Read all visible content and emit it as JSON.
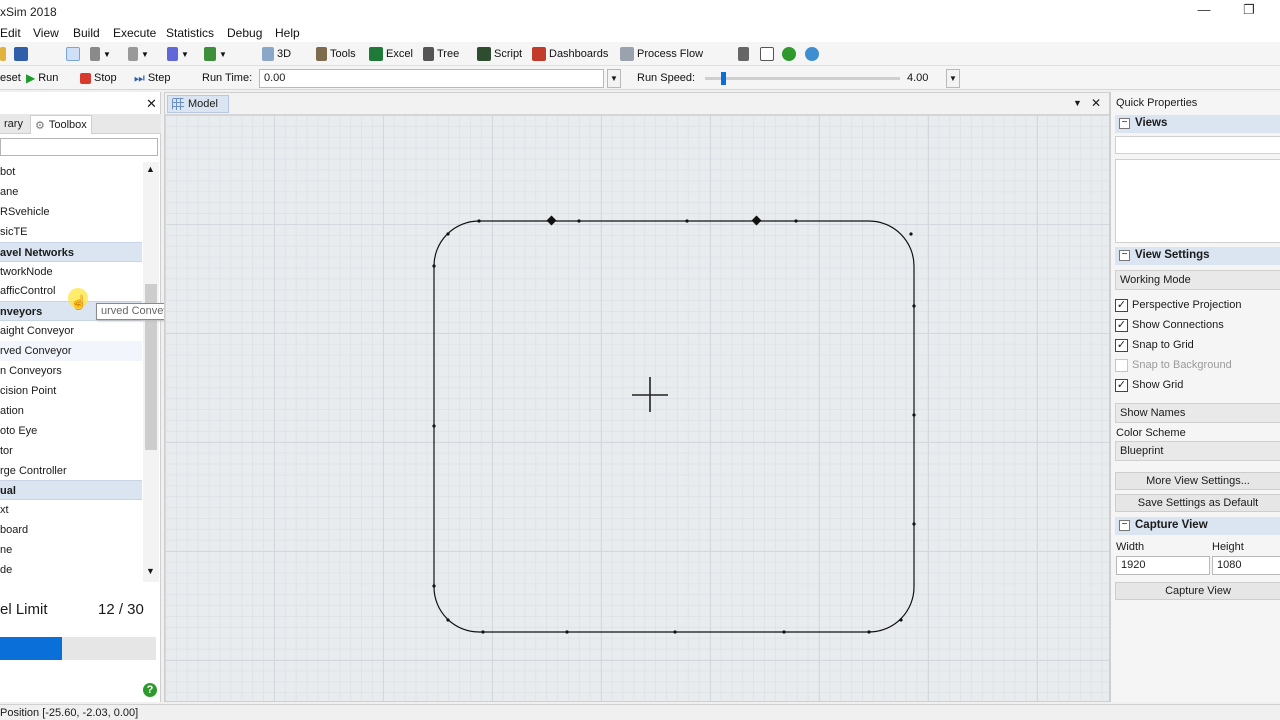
{
  "app": {
    "title": "xSim 2018",
    "minimize_glyph": "—",
    "restore_glyph": "❐"
  },
  "menu": [
    "Edit",
    "View",
    "Build",
    "Execute",
    "Statistics",
    "Debug",
    "Help"
  ],
  "toolbar": {
    "view3d": "3D",
    "tools": "Tools",
    "excel": "Excel",
    "tree": "Tree",
    "script": "Script",
    "dashboards": "Dashboards",
    "process_flow": "Process Flow"
  },
  "run_bar": {
    "reset": "eset",
    "run": "Run",
    "stop": "Stop",
    "step": "Step",
    "run_time_label": "Run Time:",
    "run_time_value": "0.00",
    "run_speed_label": "Run Speed:",
    "run_speed_value": "4.00",
    "run_speed_fraction": 0.08
  },
  "left_panel": {
    "tabs": {
      "library": "rary",
      "toolbox": "Toolbox"
    },
    "search_value": "",
    "items": [
      {
        "label": "bot",
        "type": "item"
      },
      {
        "label": "ane",
        "type": "item"
      },
      {
        "label": "RSvehicle",
        "type": "item"
      },
      {
        "label": "sicTE",
        "type": "item"
      },
      {
        "label": "avel Networks",
        "type": "header"
      },
      {
        "label": "tworkNode",
        "type": "item"
      },
      {
        "label": "afficControl",
        "type": "item"
      },
      {
        "label": "nveyors",
        "type": "header"
      },
      {
        "label": "aight Conveyor",
        "type": "item"
      },
      {
        "label": "rved Conveyor",
        "type": "hover"
      },
      {
        "label": "n Conveyors",
        "type": "item"
      },
      {
        "label": "cision Point",
        "type": "item"
      },
      {
        "label": "ation",
        "type": "item"
      },
      {
        "label": "oto Eye",
        "type": "item"
      },
      {
        "label": "tor",
        "type": "item"
      },
      {
        "label": "rge Controller",
        "type": "item"
      },
      {
        "label": "ual",
        "type": "header"
      },
      {
        "label": "xt",
        "type": "item"
      },
      {
        "label": "board",
        "type": "item"
      },
      {
        "label": "ne",
        "type": "item"
      },
      {
        "label": "de",
        "type": "item"
      }
    ],
    "tooltip": "urved Conveyor",
    "limit": {
      "label": "el Limit",
      "value": "12 / 30",
      "fraction": 0.4
    }
  },
  "viewport": {
    "tab": "Model"
  },
  "quick_properties": {
    "title": "Quick Properties",
    "views_header": "Views",
    "view_settings_header": "View Settings",
    "working_mode": "Working Mode",
    "checks": [
      {
        "label": "Perspective Projection",
        "checked": true
      },
      {
        "label": "Show Connections",
        "checked": true
      },
      {
        "label": "Snap to Grid",
        "checked": true
      },
      {
        "label": "Snap to Background",
        "checked": false
      },
      {
        "label": "Show Grid",
        "checked": true
      }
    ],
    "show_names": "Show Names",
    "color_scheme_label": "Color Scheme",
    "color_scheme_value": "Blueprint",
    "more_view_settings": "More View Settings...",
    "save_default": "Save Settings as Default",
    "capture_header": "Capture View",
    "width_label": "Width",
    "width_value": "1920",
    "height_label": "Height",
    "height_value": "1080",
    "capture_button": "Capture View"
  },
  "status": {
    "position": "Position [-25.60, -2.03, 0.00]"
  },
  "colors": {
    "accent": "#0a6fd8",
    "header": "#dbe4f1",
    "grid": "#e9ecef"
  }
}
